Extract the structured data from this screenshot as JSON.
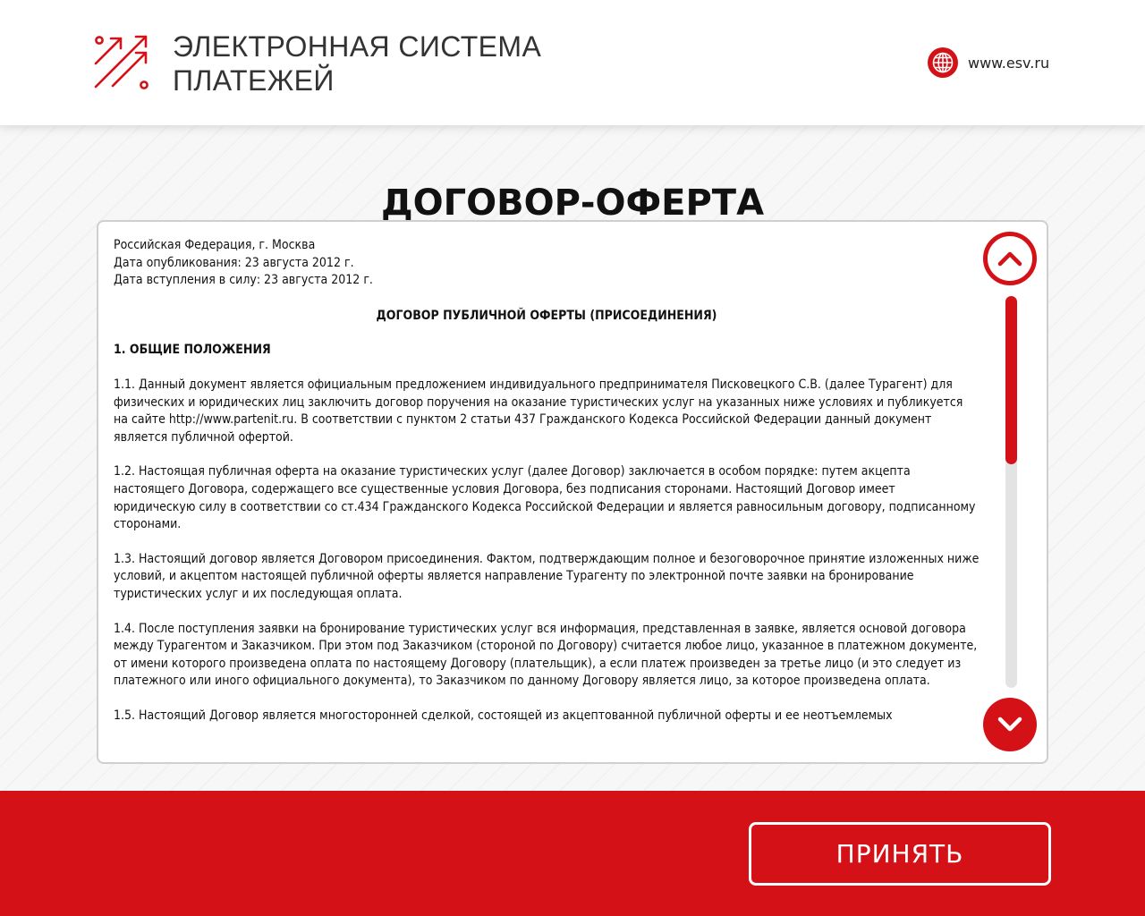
{
  "header": {
    "brand_line1": "ЭЛЕКТРОННАЯ СИСТЕМА",
    "brand_line2": "ПЛАТЕЖЕЙ",
    "site_url": "www.esv.ru",
    "logo_icon": "growth-arrows-icon",
    "site_icon": "globe-icon"
  },
  "page": {
    "title": "ДОГОВОР-ОФЕРТА"
  },
  "document": {
    "place": "Российская Федерация, г. Москва",
    "published": "Дата опубликования: 23 августа 2012 г.",
    "effective": "Дата вступления в силу: 23 августа 2012 г.",
    "contract_heading": "ДОГОВОР ПУБЛИЧНОЙ ОФЕРТЫ (ПРИСОЕДИНЕНИЯ)",
    "section_heading": "1. ОБЩИЕ ПОЛОЖЕНИЯ",
    "paragraphs": [
      "1.1. Данный документ является официальным предложением индивидуального предпринимателя Писковецкого С.В. (далее Турагент) для физических и юридических лиц заключить договор поручения на оказание туристических услуг на указанных ниже условиях и публикуется на сайте http://www.partenit.ru. В соответствии с пунктом 2 статьи 437 Гражданского Кодекса Российской Федерации данный документ является публичной офертой.",
      "1.2. Настоящая публичная оферта на оказание туристических услуг (далее Договор) заключается в особом порядке: путем акцепта настоящего Договора, содержащего все существенные условия Договора, без подписания сторонами. Настоящий Договор имеет юридическую силу в соответствии со ст.434 Гражданского Кодекса Российской Федерации и является равносильным договору, подписанному сторонами.",
      "1.3. Настоящий договор является Договором присоединения. Фактом, подтверждающим полное и безоговорочное принятие изложенных ниже условий, и акцептом настоящей публичной оферты является направление Турагенту по электронной почте заявки на бронирование туристических услуг и их последующая оплата.",
      "1.4. После поступления заявки на бронирование туристических услуг вся информация, представленная в заявке, является основой договора между Турагентом и Заказчиком. При этом под Заказчиком (стороной по Договору) считается любое лицо, указанное в платежном документе, от имени которого произведена оплата по настоящему Договору (плательщик), а если платеж произведен за третье лицо (и это следует из платежного или иного официального документа), то Заказчиком по данному Договору является лицо, за которое произведена оплата.",
      "1.5. Настоящий Договор является многосторонней сделкой, состоящей из акцептованной публичной оферты и ее неотъемлемых"
    ]
  },
  "scroll": {
    "up_icon": "chevron-up-icon",
    "down_icon": "chevron-down-icon",
    "position_fraction": 0.0,
    "visible_fraction": 0.43
  },
  "footer": {
    "accept_label": "ПРИНЯТЬ"
  },
  "colors": {
    "accent": "#d51118",
    "track": "#e3e3e3",
    "panel_border": "#cfcfcf"
  }
}
